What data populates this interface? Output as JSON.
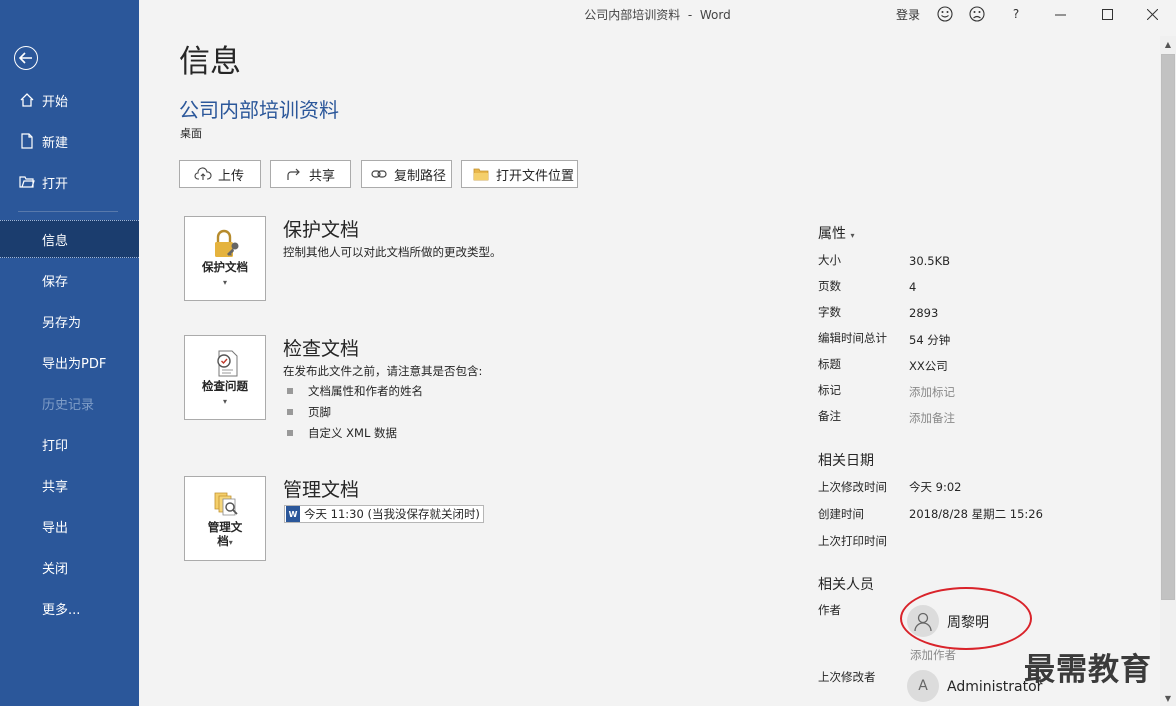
{
  "window": {
    "title": "公司内部培训资料  -  Word",
    "sign_in": "登录",
    "help": "?"
  },
  "sidebar": {
    "items": [
      {
        "label": "开始",
        "icon": "home-icon"
      },
      {
        "label": "新建",
        "icon": "new-document-icon"
      },
      {
        "label": "打开",
        "icon": "open-folder-icon"
      },
      {
        "label": "信息"
      },
      {
        "label": "保存"
      },
      {
        "label": "另存为"
      },
      {
        "label": "导出为PDF"
      },
      {
        "label": "历史记录"
      },
      {
        "label": "打印"
      },
      {
        "label": "共享"
      },
      {
        "label": "导出"
      },
      {
        "label": "关闭"
      },
      {
        "label": "更多..."
      }
    ],
    "selected": "信息",
    "disabled": "历史记录"
  },
  "info": {
    "heading": "信息",
    "doc_name": "公司内部培训资料",
    "location": "桌面"
  },
  "actions": {
    "upload": "上传",
    "share": "共享",
    "copy_path": "复制路径",
    "open_location": "打开文件位置"
  },
  "protect": {
    "tile_label": "保护文档",
    "title": "保护文档",
    "desc": "控制其他人可以对此文档所做的更改类型。"
  },
  "inspect": {
    "tile_label": "检查问题",
    "title": "检查文档",
    "desc": "在发布此文件之前，请注意其是否包含:",
    "bullets": [
      "文档属性和作者的姓名",
      "页脚",
      "自定义 XML 数据"
    ]
  },
  "manage": {
    "tile_label_1": "管理文",
    "tile_label_2": "档",
    "title": "管理文档",
    "version": "今天 11:30 (当我没保存就关闭时)"
  },
  "properties": {
    "header": "属性",
    "rows": [
      {
        "key": "大小",
        "value": "30.5KB"
      },
      {
        "key": "页数",
        "value": "4"
      },
      {
        "key": "字数",
        "value": "2893"
      },
      {
        "key": "编辑时间总计",
        "value": "54 分钟"
      },
      {
        "key": "标题",
        "value": "XX公司"
      },
      {
        "key": "标记",
        "value": "添加标记"
      },
      {
        "key": "备注",
        "value": "添加备注"
      }
    ]
  },
  "dates": {
    "header": "相关日期",
    "rows": [
      {
        "key": "上次修改时间",
        "value": "今天 9:02"
      },
      {
        "key": "创建时间",
        "value": "2018/8/28 星期二 15:26"
      },
      {
        "key": "上次打印时间",
        "value": ""
      }
    ]
  },
  "people": {
    "header": "相关人员",
    "author_label": "作者",
    "author_name": "周黎明",
    "add_author": "添加作者",
    "last_modified_label": "上次修改者",
    "last_modified_initial": "A",
    "last_modified_name": "Administrator"
  },
  "watermark": "最需教育",
  "colors": {
    "accent": "#2b579a",
    "sidebar_selected": "#1b3d6e",
    "annotation": "#d9232a",
    "background": "#f3f3f3"
  }
}
